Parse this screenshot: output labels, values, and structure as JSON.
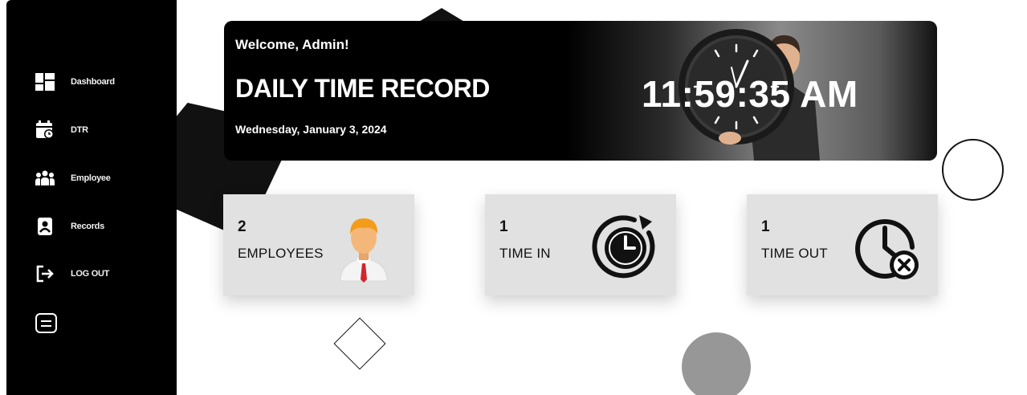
{
  "sidebar": {
    "items": [
      {
        "label": "Dashboard",
        "icon": "dashboard-icon"
      },
      {
        "label": "DTR",
        "icon": "calendar-icon"
      },
      {
        "label": "Employee",
        "icon": "employees-icon"
      },
      {
        "label": "Records",
        "icon": "records-icon"
      },
      {
        "label": "LOG OUT",
        "icon": "logout-icon"
      }
    ],
    "menu_icon": "menu-icon"
  },
  "banner": {
    "welcome": "Welcome, Admin!",
    "title": "DAILY TIME RECORD",
    "date": "Wednesday, January 3, 2024",
    "time": "11:59:35 AM"
  },
  "cards": [
    {
      "count": "2",
      "label": "EMPLOYEES",
      "icon": "employee-avatar-icon"
    },
    {
      "count": "1",
      "label": "TIME IN",
      "icon": "clock-refresh-icon"
    },
    {
      "count": "1",
      "label": "TIME OUT",
      "icon": "clock-cancel-icon"
    }
  ],
  "colors": {
    "sidebar": "#000000",
    "card": "#e1e1e1",
    "accent_red": "#d0262f",
    "skin": "#f4b77a"
  }
}
